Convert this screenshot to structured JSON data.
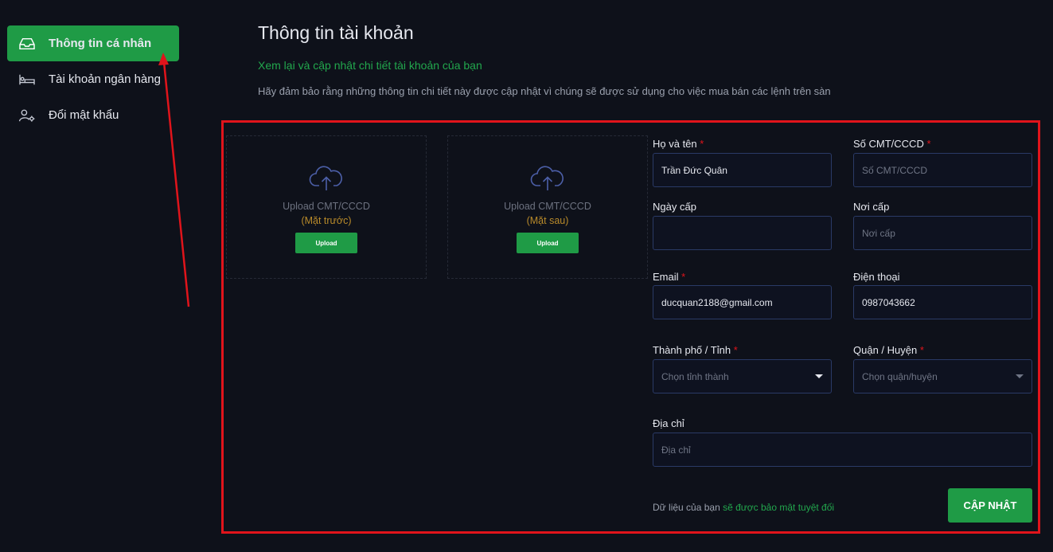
{
  "sidebar": {
    "items": [
      {
        "label": "Thông tin cá nhân",
        "icon": "inbox-icon",
        "active": true
      },
      {
        "label": "Tài khoản ngân hàng",
        "icon": "bed-icon",
        "active": false
      },
      {
        "label": "Đổi mật khẩu",
        "icon": "user-gear-icon",
        "active": false
      }
    ]
  },
  "main": {
    "title": "Thông tin tài khoản",
    "subtitle": "Xem lại và cập nhật chi tiết tài khoản của bạn",
    "description": "Hãy đảm bảo rằng những thông tin chi tiết này được cập nhật vì chúng sẽ được sử dụng cho việc mua bán các lệnh trên sàn"
  },
  "uploads": [
    {
      "label": "Upload CMT/CCCD",
      "side": "(Mặt trước)",
      "button": "Upload"
    },
    {
      "label": "Upload CMT/CCCD",
      "side": "(Mặt sau)",
      "button": "Upload"
    }
  ],
  "form": {
    "full_name": {
      "label": "Họ và tên",
      "value": "Trần Đức Quân"
    },
    "id_number": {
      "label": "Số CMT/CCCD",
      "placeholder": "Số CMT/CCCD"
    },
    "issue_date": {
      "label": "Ngày cấp",
      "value": ""
    },
    "issue_place": {
      "label": "Nơi cấp",
      "placeholder": "Nơi cấp"
    },
    "email": {
      "label": "Email",
      "value": "ducquan2188@gmail.com"
    },
    "phone": {
      "label": "Điện thoại",
      "value": "0987043662"
    },
    "city": {
      "label": "Thành phố / Tỉnh",
      "placeholder": "Chọn tỉnh thành"
    },
    "district": {
      "label": "Quận / Huyện",
      "placeholder": "Chọn quận/huyện"
    },
    "address": {
      "label": "Địa chỉ",
      "placeholder": "Địa chỉ"
    },
    "required_mark": "*"
  },
  "footer": {
    "note_prefix": "Dữ liệu của bạn",
    "note_green": "sẽ được bảo mật tuyệt đối",
    "update_button": "CẬP NHẬT"
  },
  "colors": {
    "accent": "#1f9b46",
    "highlight": "#e0141b",
    "background": "#0e111a"
  }
}
